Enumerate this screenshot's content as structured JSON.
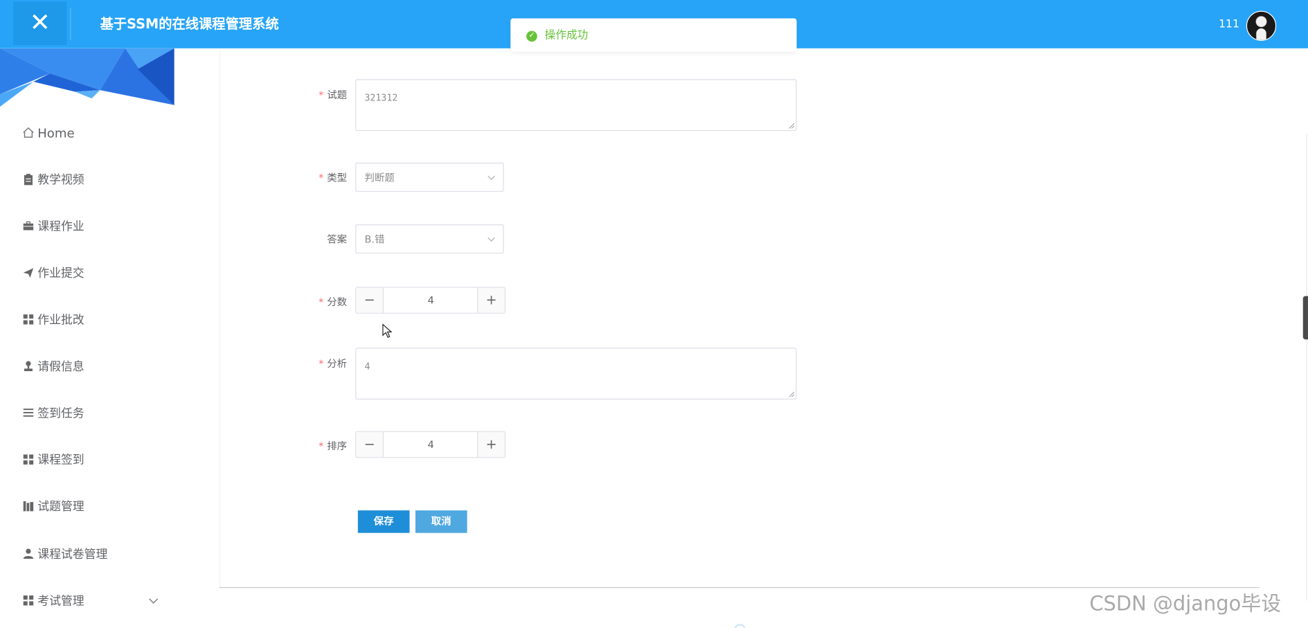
{
  "header": {
    "close_symbol": "✕",
    "title": "基于SSM的在线课程管理系统",
    "user_name": "111",
    "bg_color": "#27a4f7"
  },
  "toast": {
    "icon": "check-circle-icon",
    "message": "操作成功",
    "color": "#67c23a"
  },
  "sidebar": {
    "items": [
      {
        "label": "Home",
        "icon": "home-icon"
      },
      {
        "label": "教学视频",
        "icon": "clipboard-icon"
      },
      {
        "label": "课程作业",
        "icon": "briefcase-icon"
      },
      {
        "label": "作业提交",
        "icon": "paper-plane-icon"
      },
      {
        "label": "作业批改",
        "icon": "grid-icon"
      },
      {
        "label": "请假信息",
        "icon": "stamp-icon"
      },
      {
        "label": "签到任务",
        "icon": "list-icon"
      },
      {
        "label": "课程签到",
        "icon": "grid-icon"
      },
      {
        "label": "试题管理",
        "icon": "books-icon"
      },
      {
        "label": "课程试卷管理",
        "icon": "user-icon"
      },
      {
        "label": "考试管理",
        "icon": "grid-icon",
        "expandable": true
      }
    ]
  },
  "form": {
    "question": {
      "label": "试题",
      "required": true,
      "value": "321312"
    },
    "type": {
      "label": "类型",
      "required": true,
      "value": "判断题"
    },
    "answer": {
      "label": "答案",
      "required": false,
      "value": "B.错"
    },
    "score": {
      "label": "分数",
      "required": true,
      "value": "4",
      "minus": "−",
      "plus": "+"
    },
    "analysis": {
      "label": "分析",
      "required": true,
      "value": "4"
    },
    "order": {
      "label": "排序",
      "required": true,
      "value": "4",
      "minus": "−",
      "plus": "+"
    },
    "required_mark": "*",
    "save_label": "保存",
    "cancel_label": "取消",
    "save_color": "#1f8ed8",
    "cancel_color": "#4fa8e0"
  },
  "watermark": "CSDN @django毕设"
}
